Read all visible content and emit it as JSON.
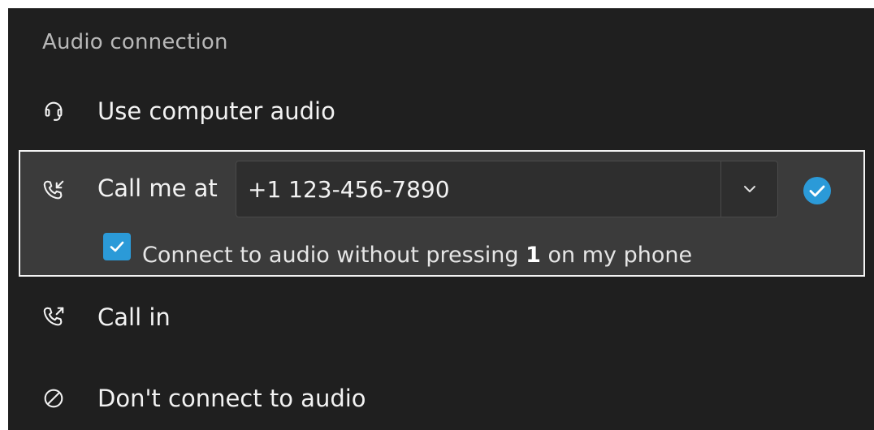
{
  "audio_panel": {
    "section_title": "Audio connection",
    "options": {
      "computer_audio": {
        "label": "Use computer audio",
        "icon": "headset-icon"
      },
      "call_me": {
        "label": "Call me at",
        "icon": "phone-callback-icon",
        "phone_number": "+1 123-456-7890",
        "selected": true,
        "dropdown_icon": "chevron-down-icon",
        "selected_icon": "check-circle-icon",
        "auto_connect": {
          "checked": true,
          "label_before": "Connect to audio without pressing ",
          "label_bold": "1",
          "label_after": " on my phone"
        }
      },
      "call_in": {
        "label": "Call in",
        "icon": "phone-outgoing-icon"
      },
      "no_audio": {
        "label": "Don't connect to audio",
        "icon": "prohibited-icon"
      }
    }
  },
  "colors": {
    "panel_bg": "#1f1f1f",
    "selected_bg": "#3b3b3b",
    "selected_border": "#f4f4f4",
    "accent": "#2b9ad8",
    "text": "#f2f2f2",
    "muted_text": "#b8b8b8"
  }
}
